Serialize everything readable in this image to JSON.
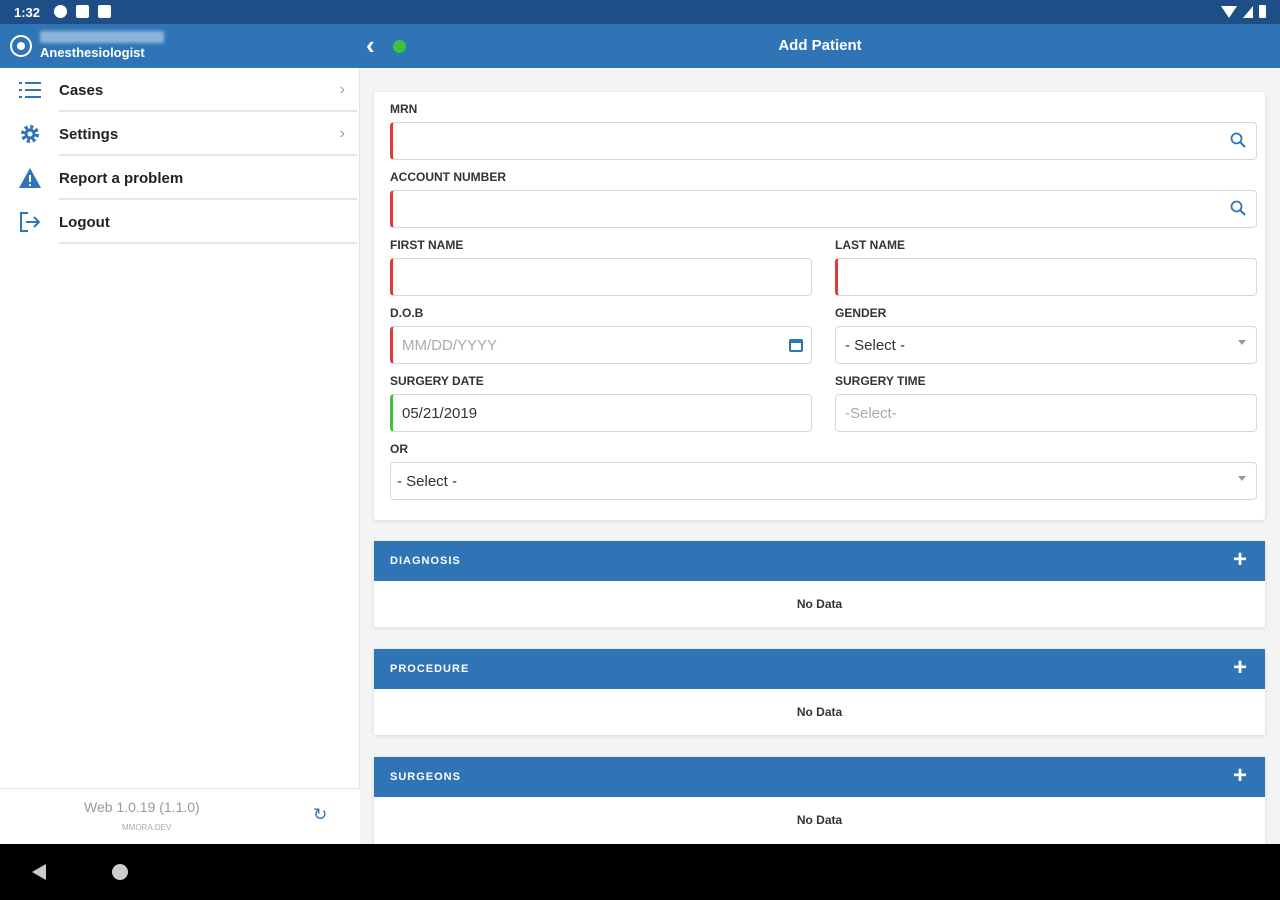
{
  "status_bar": {
    "time": "1:32"
  },
  "header": {
    "user_role": "Anesthesiologist",
    "title": "Add Patient"
  },
  "sidebar": {
    "items": [
      {
        "label": "Cases",
        "icon": "list-icon"
      },
      {
        "label": "Settings",
        "icon": "gear-icon"
      },
      {
        "label": "Report a problem",
        "icon": "warning-icon"
      },
      {
        "label": "Logout",
        "icon": "logout-icon"
      }
    ],
    "version": "Web 1.0.19 (1.1.0)",
    "host": "MMORA.DEV"
  },
  "form": {
    "mrn": {
      "label": "MRN",
      "value": ""
    },
    "account_number": {
      "label": "ACCOUNT NUMBER",
      "value": ""
    },
    "first_name": {
      "label": "FIRST NAME",
      "value": ""
    },
    "last_name": {
      "label": "LAST NAME",
      "value": ""
    },
    "dob": {
      "label": "D.O.B",
      "placeholder": "MM/DD/YYYY"
    },
    "gender": {
      "label": "GENDER",
      "value": "- Select -"
    },
    "surgery_date": {
      "label": "SURGERY DATE",
      "value": "05/21/2019"
    },
    "surgery_time": {
      "label": "SURGERY TIME",
      "placeholder": "-Select-"
    },
    "or": {
      "label": "OR",
      "value": "- Select -"
    }
  },
  "sections": [
    {
      "title": "DIAGNOSIS",
      "empty_text": "No Data"
    },
    {
      "title": "PROCEDURE",
      "empty_text": "No Data"
    },
    {
      "title": "SURGEONS",
      "empty_text": "No Data"
    }
  ],
  "colors": {
    "primary": "#2f75b5",
    "status_bar": "#1f4e86",
    "required": "#e03a3a",
    "valid": "#3ec23e"
  }
}
